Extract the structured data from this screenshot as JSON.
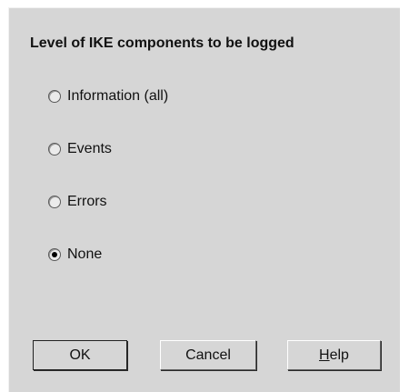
{
  "dialog": {
    "title": "Level of IKE components to be logged"
  },
  "options": [
    {
      "label": "Information (all)",
      "checked": false
    },
    {
      "label": "Events",
      "checked": false
    },
    {
      "label": "Errors",
      "checked": false
    },
    {
      "label": "None",
      "checked": true
    }
  ],
  "buttons": {
    "ok": "OK",
    "cancel": "Cancel",
    "help_mnemonic": "H",
    "help_rest": "elp"
  }
}
